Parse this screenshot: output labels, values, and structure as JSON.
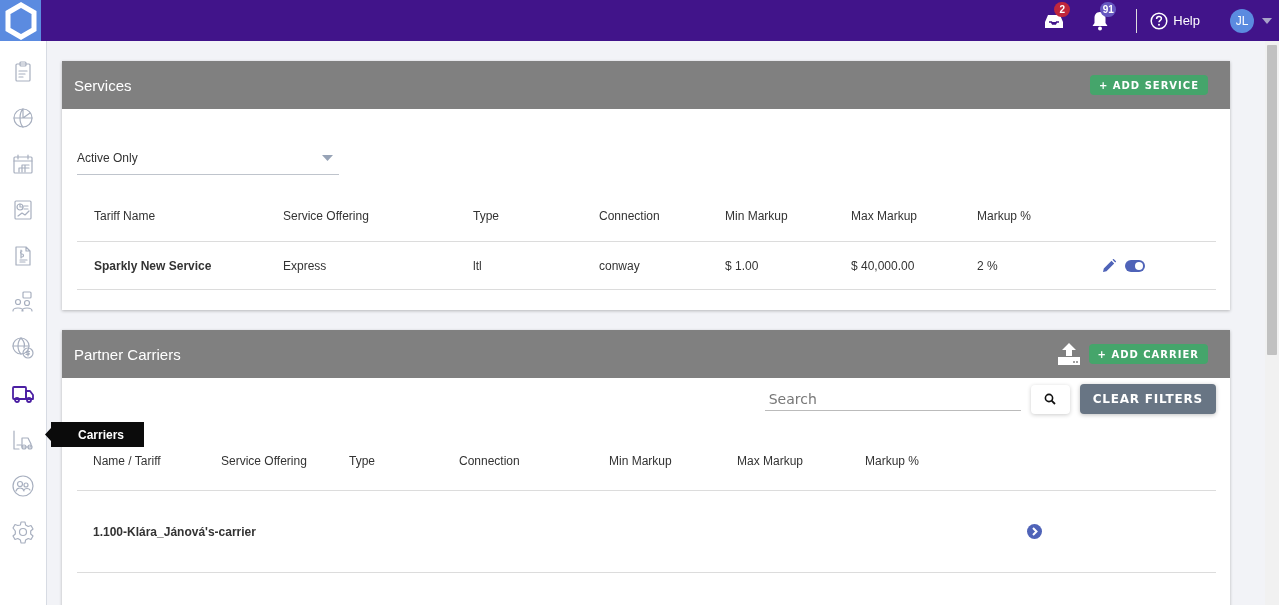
{
  "top_bar": {
    "inbox_badge": "2",
    "notifications_badge": "91",
    "help": "Help",
    "avatar": "JL"
  },
  "sidebar": {
    "items": [
      {
        "selected": false
      },
      {
        "selected": false
      },
      {
        "selected": false
      },
      {
        "selected": false
      },
      {
        "selected": false
      },
      {
        "selected": false
      },
      {
        "selected": false
      },
      {
        "selected": true
      },
      {
        "selected": false
      },
      {
        "selected": false
      },
      {
        "selected": false
      }
    ],
    "tooltip": "Carriers"
  },
  "services": {
    "title": "Services",
    "add_button": "+ ADD SERVICE",
    "filter": {
      "value": "Active Only"
    },
    "columns": [
      "Tariff Name",
      "Service Offering",
      "Type",
      "Connection",
      "Min Markup",
      "Max Markup",
      "Markup %"
    ],
    "rows": [
      {
        "cells": [
          "Sparkly New Service",
          "Express",
          "ltl",
          "conway",
          "$ 1.00",
          "$ 40,000.00",
          "2 %"
        ],
        "enabled": true
      }
    ]
  },
  "partner_carriers": {
    "title": "Partner Carriers",
    "add_button": "+ ADD CARRIER",
    "search": {
      "placeholder": "Search"
    },
    "clear_button": "CLEAR FILTERS",
    "columns": [
      "Name / Tariff",
      "Service Offering",
      "Type",
      "Connection",
      "Min Markup",
      "Max Markup",
      "Markup %"
    ],
    "rows": [
      {
        "name": "1.100-Klára_Jánová's-carrier"
      }
    ]
  }
}
